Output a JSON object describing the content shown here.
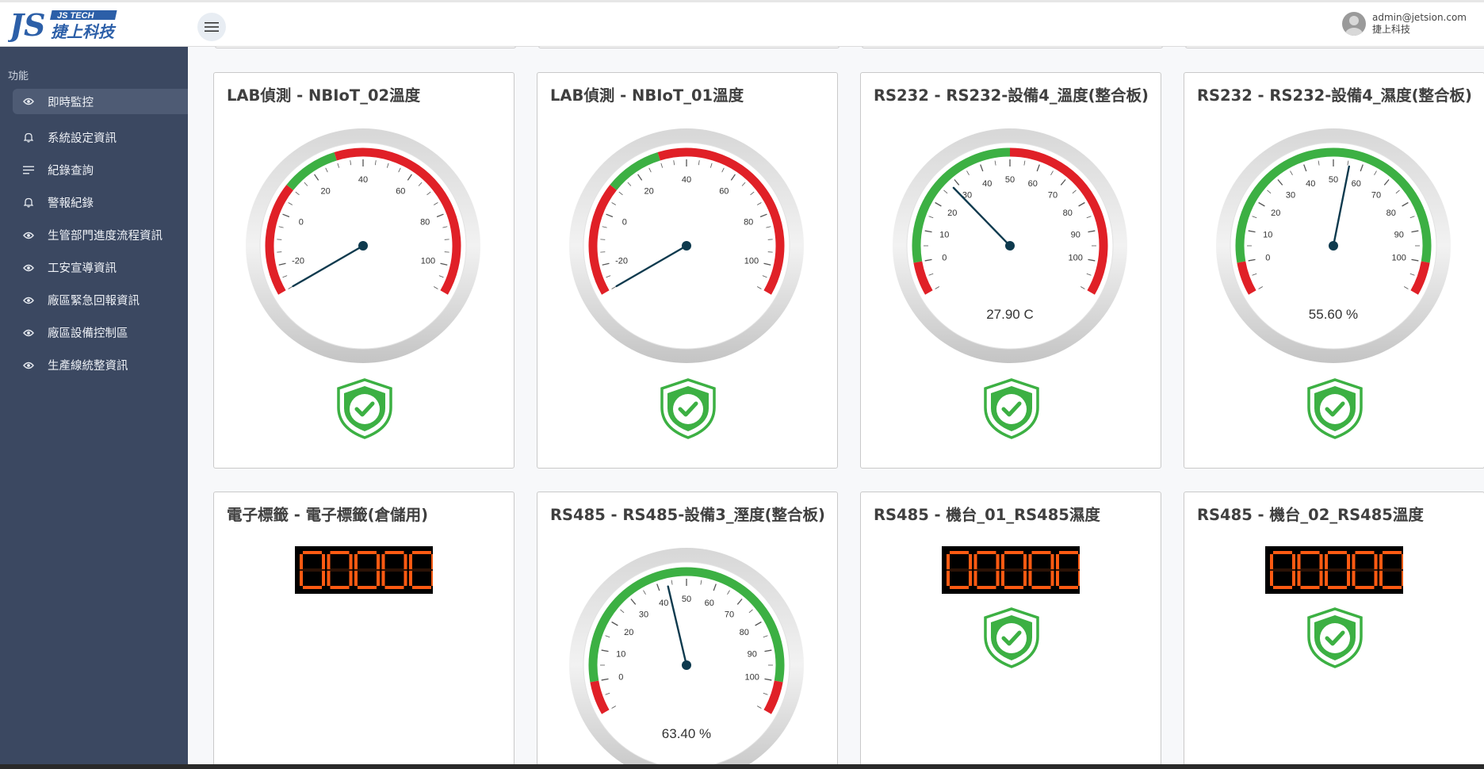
{
  "header": {
    "logo_tag": "JS TECH",
    "logo_name": "捷上科技",
    "user_email": "admin@jetsion.com",
    "user_company": "捷上科技"
  },
  "sidebar": {
    "section": "功能",
    "items": [
      {
        "label": "即時監控",
        "icon": "eye-icon",
        "active": true
      },
      {
        "label": "系統設定資訊",
        "icon": "bell-icon"
      },
      {
        "label": "紀錄查詢",
        "icon": "list-icon"
      },
      {
        "label": "警報紀錄",
        "icon": "bell-icon"
      },
      {
        "label": "生管部門進度流程資訊",
        "icon": "eye-icon"
      },
      {
        "label": "工安宣導資訊",
        "icon": "eye-icon"
      },
      {
        "label": "廠區緊急回報資訊",
        "icon": "eye-icon"
      },
      {
        "label": "廠區設備控制區",
        "icon": "eye-icon"
      },
      {
        "label": "生產線統整資訊",
        "icon": "eye-icon"
      }
    ]
  },
  "cards": [
    {
      "title": "LAB偵測 - NBIoT_02溫度",
      "gauge": {
        "type": "temp",
        "value": -30,
        "readout": ""
      },
      "status_icon": "shield-check-icon"
    },
    {
      "title": "LAB偵測 - NBIoT_01溫度",
      "gauge": {
        "type": "temp",
        "value": -30,
        "readout": ""
      },
      "status_icon": "shield-check-icon"
    },
    {
      "title": "RS232 - RS232-設備4_溫度(整合板)",
      "gauge": {
        "type": "pct",
        "value": 27.9,
        "readout": "27.90 C"
      },
      "status_icon": "shield-check-icon"
    },
    {
      "title": "RS232 - RS232-設備4_濕度(整合板)",
      "gauge": {
        "type": "pct",
        "value": 55.6,
        "readout": "55.60 %"
      },
      "status_icon": "shield-check-icon"
    },
    {
      "title": "電子標籤 - 電子標籤(倉儲用)",
      "display": "00000"
    },
    {
      "title": "RS485 - RS485-設備3_溼度(整合板)",
      "gauge": {
        "type": "pct",
        "value": 43.4,
        "readout": "63.40 %"
      }
    },
    {
      "title": "RS485 - 機台_01_RS485濕度",
      "display": "00000",
      "status_icon": "shield-check-icon"
    },
    {
      "title": "RS485 - 機台_02_RS485溫度",
      "display": "00000",
      "status_icon": "shield-check-icon"
    }
  ],
  "colors": {
    "green": "#3cb043",
    "red": "#e02027",
    "sidebar": "#3b4861",
    "needle": "#0e3a4e",
    "digit": "#ff5a12"
  }
}
